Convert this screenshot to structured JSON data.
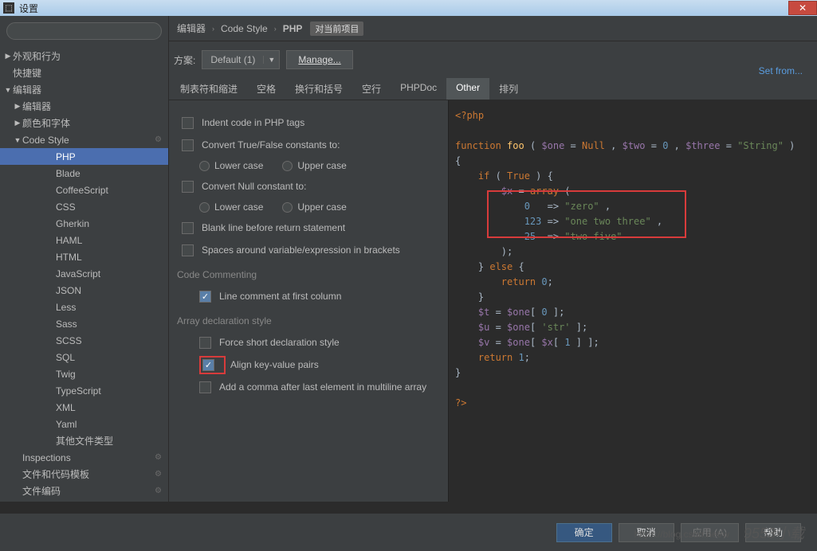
{
  "window": {
    "title": "设置"
  },
  "search": {
    "placeholder": ""
  },
  "sidebar": {
    "items": [
      {
        "label": "外观和行为",
        "depth": 0,
        "arrow": "right"
      },
      {
        "label": "快捷键",
        "depth": 0,
        "arrow": "none"
      },
      {
        "label": "编辑器",
        "depth": 0,
        "arrow": "down"
      },
      {
        "label": "编辑器",
        "depth": 1,
        "arrow": "right"
      },
      {
        "label": "颜色和字体",
        "depth": 1,
        "arrow": "right"
      },
      {
        "label": "Code Style",
        "depth": 1,
        "arrow": "down",
        "gear": true
      },
      {
        "label": "PHP",
        "depth": 3,
        "arrow": "none",
        "selected": true
      },
      {
        "label": "Blade",
        "depth": 3,
        "arrow": "none"
      },
      {
        "label": "CoffeeScript",
        "depth": 3,
        "arrow": "none"
      },
      {
        "label": "CSS",
        "depth": 3,
        "arrow": "none"
      },
      {
        "label": "Gherkin",
        "depth": 3,
        "arrow": "none"
      },
      {
        "label": "HAML",
        "depth": 3,
        "arrow": "none"
      },
      {
        "label": "HTML",
        "depth": 3,
        "arrow": "none"
      },
      {
        "label": "JavaScript",
        "depth": 3,
        "arrow": "none"
      },
      {
        "label": "JSON",
        "depth": 3,
        "arrow": "none"
      },
      {
        "label": "Less",
        "depth": 3,
        "arrow": "none"
      },
      {
        "label": "Sass",
        "depth": 3,
        "arrow": "none"
      },
      {
        "label": "SCSS",
        "depth": 3,
        "arrow": "none"
      },
      {
        "label": "SQL",
        "depth": 3,
        "arrow": "none"
      },
      {
        "label": "Twig",
        "depth": 3,
        "arrow": "none"
      },
      {
        "label": "TypeScript",
        "depth": 3,
        "arrow": "none"
      },
      {
        "label": "XML",
        "depth": 3,
        "arrow": "none"
      },
      {
        "label": "Yaml",
        "depth": 3,
        "arrow": "none"
      },
      {
        "label": "其他文件类型",
        "depth": 3,
        "arrow": "none"
      },
      {
        "label": "Inspections",
        "depth": 1,
        "arrow": "none",
        "gear": true
      },
      {
        "label": "文件和代码模板",
        "depth": 1,
        "arrow": "none",
        "gear": true
      },
      {
        "label": "文件编码",
        "depth": 1,
        "arrow": "none",
        "gear": true
      }
    ]
  },
  "breadcrumb": {
    "a": "编辑器",
    "b": "Code Style",
    "c": "PHP",
    "badge": "对当前项目"
  },
  "setfrom": "Set from...",
  "scheme": {
    "label": "方案:",
    "value": "Default (1)",
    "manage": "Manage..."
  },
  "tabs": [
    "制表符和缩进",
    "空格",
    "换行和括号",
    "空行",
    "PHPDoc",
    "Other",
    "排列"
  ],
  "tabs_active": 5,
  "options": {
    "indent_php": "Indent code in PHP tags",
    "convert_tf": "Convert True/False constants to:",
    "lower": "Lower case",
    "upper": "Upper case",
    "convert_null": "Convert Null constant to:",
    "blank_return": "Blank line before return statement",
    "spaces_var": "Spaces around variable/expression in brackets",
    "sec_comment": "Code Commenting",
    "line_comment": "Line comment at first column",
    "sec_array": "Array declaration style",
    "force_short": "Force short declaration style",
    "align_kv": "Align key-value pairs",
    "trailing_comma": "Add a comma after last element in multiline array"
  },
  "buttons": {
    "ok": "确定",
    "cancel": "取消",
    "apply": "应用 (A)",
    "help": "帮助"
  },
  "watermark": {
    "site": "9553小载",
    "blog": "https://blog.csdn.net/w"
  }
}
